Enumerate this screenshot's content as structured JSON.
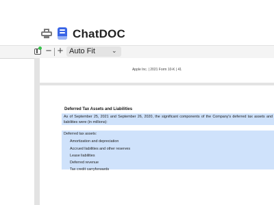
{
  "app": {
    "title": "ChatDOC",
    "brand_color": "#3a66e6"
  },
  "icons": {
    "print": "printer-icon",
    "logo": "chatdoc-logo-icon",
    "sidebar": "sidebar-toggle-icon"
  },
  "toolbar": {
    "zoom_out": "−",
    "zoom_in": "+",
    "zoom_mode": "Auto Fit",
    "chevron": "⌄"
  },
  "document": {
    "page_footer": "Apple Inc. | 2021 Form 10-K | 41",
    "section_heading": "Deferred Tax Assets and Liabilities",
    "intro": "As of September 25, 2021 and September 26, 2020, the significant components of the Company's deferred tax assets and liabilities were (in millions):",
    "table": {
      "group_label": "Deferred tax assets:",
      "rows": [
        "Amortization and depreciation",
        "Accrued liabilities and other reserves",
        "Lease liabilities",
        "Deferred revenue",
        "Tax credit carryforwards"
      ]
    },
    "highlight_color": "#cfe2fb"
  }
}
